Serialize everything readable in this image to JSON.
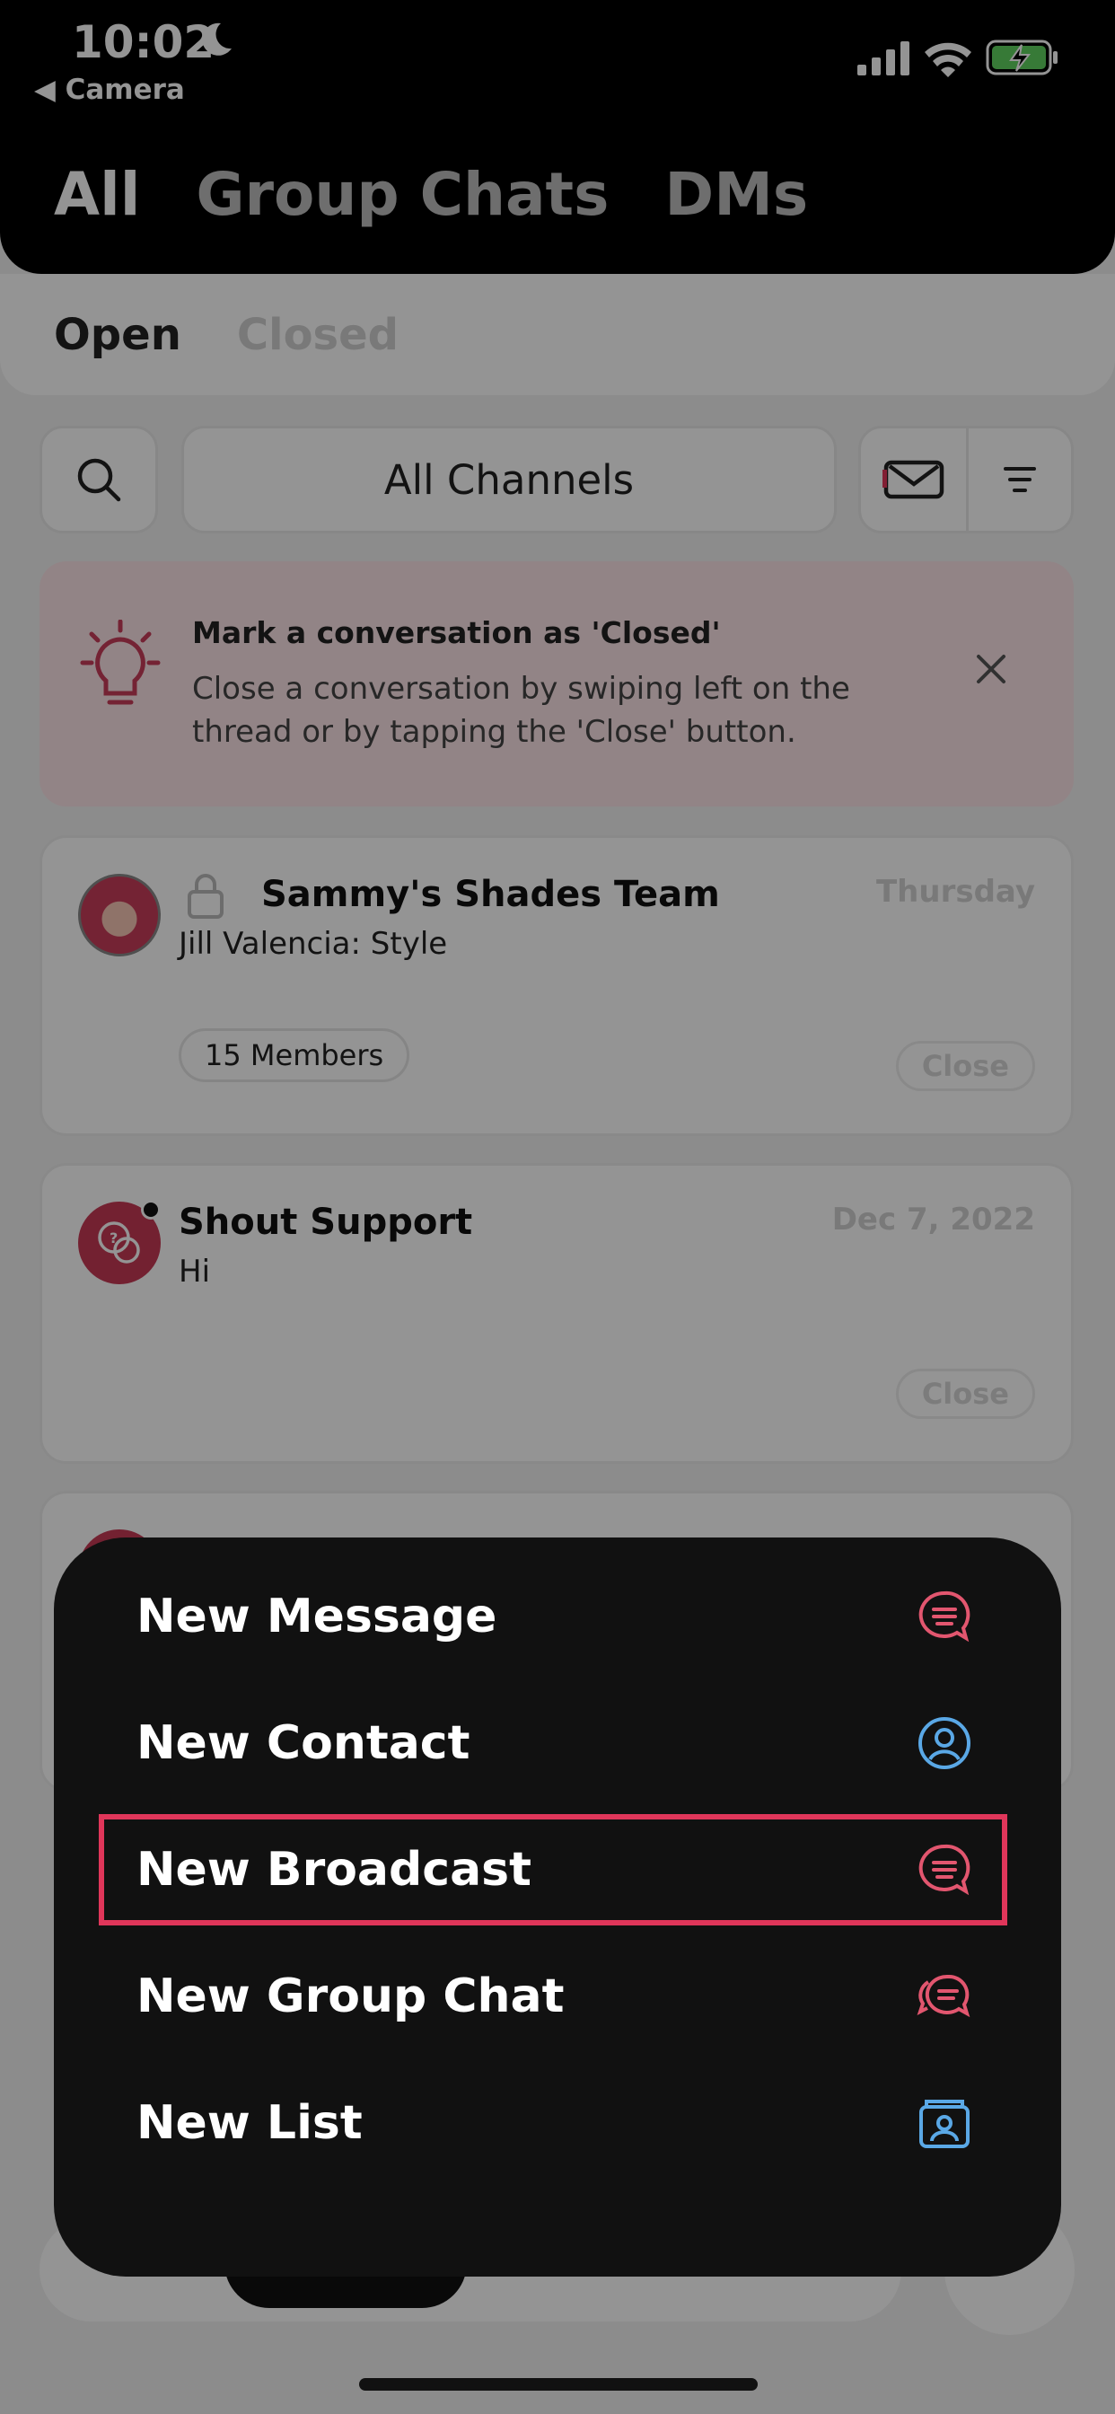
{
  "status_bar": {
    "time": "10:02",
    "back_app": "Camera"
  },
  "top_tabs": [
    {
      "label": "All",
      "active": true
    },
    {
      "label": "Group Chats",
      "active": false
    },
    {
      "label": "DMs",
      "active": false
    }
  ],
  "sub_tabs": [
    {
      "label": "Open",
      "active": true
    },
    {
      "label": "Closed",
      "active": false
    }
  ],
  "toolbar": {
    "channels_label": "All Channels"
  },
  "tip": {
    "title": "Mark a conversation as 'Closed'",
    "body": "Close a conversation by swiping left on the thread or by tapping the 'Close' button."
  },
  "conversations": [
    {
      "title": "Sammy's Shades Team",
      "date": "Thursday",
      "preview": "Jill Valencia: Style",
      "members": "15 Members",
      "close_label": "Close"
    },
    {
      "title": "Shout Support",
      "date": "Dec 7, 2022",
      "preview": "Hi",
      "close_label": "Close"
    }
  ],
  "menu": {
    "items": [
      {
        "label": "New Message",
        "icon": "chat-bubble-icon",
        "color": "#e2566f"
      },
      {
        "label": "New Contact",
        "icon": "contact-icon",
        "color": "#5aa8e6"
      },
      {
        "label": "New Broadcast",
        "icon": "broadcast-icon",
        "color": "#e2566f",
        "highlighted": true
      },
      {
        "label": "New Group Chat",
        "icon": "group-chat-icon",
        "color": "#e2566f"
      },
      {
        "label": "New List",
        "icon": "list-icon",
        "color": "#5aa8e6"
      }
    ]
  },
  "colors": {
    "accent": "#e0365a",
    "blue": "#5aa8e6",
    "menu_bg": "#111111"
  }
}
